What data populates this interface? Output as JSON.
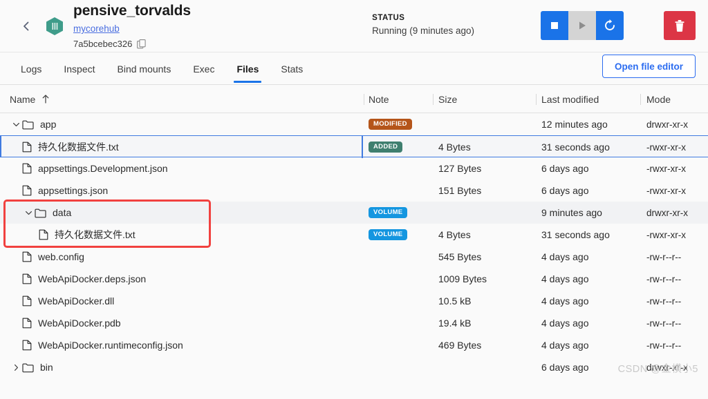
{
  "header": {
    "back_icon": "chevron-left-icon",
    "container_icon": "docker-container-icon",
    "title": "pensive_torvalds",
    "image_link": "mycorehub",
    "container_id": "7a5bcebec326",
    "copy_icon": "copy-icon",
    "status_label": "STATUS",
    "status_value": "Running (9 minutes ago)",
    "actions": {
      "stop": "stop-icon",
      "start": "play-icon",
      "restart": "restart-icon",
      "delete": "trash-icon"
    },
    "colors": {
      "primary_blue": "#1a73e8",
      "danger_red": "#dc3545",
      "disabled_gray": "#d4d4d4",
      "container_teal": "#3f9c8a",
      "link_blue": "#4a6ee0"
    }
  },
  "tabs": [
    {
      "label": "Logs",
      "active": false
    },
    {
      "label": "Inspect",
      "active": false
    },
    {
      "label": "Bind mounts",
      "active": false
    },
    {
      "label": "Exec",
      "active": false
    },
    {
      "label": "Files",
      "active": true
    },
    {
      "label": "Stats",
      "active": false
    }
  ],
  "toolbar": {
    "open_file_editor_label": "Open file editor"
  },
  "columns": {
    "name": "Name",
    "sort_icon": "sort-ascending-arrow-icon",
    "note": "Note",
    "size": "Size",
    "last_modified": "Last modified",
    "mode": "Mode"
  },
  "badge_colors": {
    "MODIFIED": "#b5551a",
    "ADDED": "#3f7f6f",
    "VOLUME": "#1496e0"
  },
  "rows": [
    {
      "name": "app",
      "type": "folder",
      "indent": 0,
      "chevron": "chevron-down-icon",
      "note": "MODIFIED",
      "size": "",
      "modified": "12 minutes ago",
      "mode": "drwxr-xr-x",
      "stripe": false,
      "selected": false
    },
    {
      "name": "持久化数据文件.txt",
      "type": "file",
      "indent": 1,
      "chevron": "",
      "note": "ADDED",
      "size": "4 Bytes",
      "modified": "31 seconds ago",
      "mode": "-rwxr-xr-x",
      "stripe": true,
      "selected": true
    },
    {
      "name": "appsettings.Development.json",
      "type": "file",
      "indent": 1,
      "chevron": "",
      "note": "",
      "size": "127 Bytes",
      "modified": "6 days ago",
      "mode": "-rwxr-xr-x",
      "stripe": false,
      "selected": false
    },
    {
      "name": "appsettings.json",
      "type": "file",
      "indent": 1,
      "chevron": "",
      "note": "",
      "size": "151 Bytes",
      "modified": "6 days ago",
      "mode": "-rwxr-xr-x",
      "stripe": false,
      "selected": false
    },
    {
      "name": "data",
      "type": "folder",
      "indent": 1,
      "chevron": "chevron-down-icon",
      "note": "VOLUME",
      "size": "",
      "modified": "9 minutes ago",
      "mode": "drwxr-xr-x",
      "stripe": true,
      "selected": false
    },
    {
      "name": "持久化数据文件.txt",
      "type": "file",
      "indent": 2,
      "chevron": "",
      "note": "VOLUME",
      "size": "4 Bytes",
      "modified": "31 seconds ago",
      "mode": "-rwxr-xr-x",
      "stripe": false,
      "selected": false
    },
    {
      "name": "web.config",
      "type": "file",
      "indent": 1,
      "chevron": "",
      "note": "",
      "size": "545 Bytes",
      "modified": "4 days ago",
      "mode": "-rw-r--r--",
      "stripe": false,
      "selected": false
    },
    {
      "name": "WebApiDocker.deps.json",
      "type": "file",
      "indent": 1,
      "chevron": "",
      "note": "",
      "size": "1009 Bytes",
      "modified": "4 days ago",
      "mode": "-rw-r--r--",
      "stripe": false,
      "selected": false
    },
    {
      "name": "WebApiDocker.dll",
      "type": "file",
      "indent": 1,
      "chevron": "",
      "note": "",
      "size": "10.5 kB",
      "modified": "4 days ago",
      "mode": "-rw-r--r--",
      "stripe": false,
      "selected": false
    },
    {
      "name": "WebApiDocker.pdb",
      "type": "file",
      "indent": 1,
      "chevron": "",
      "note": "",
      "size": "19.4 kB",
      "modified": "4 days ago",
      "mode": "-rw-r--r--",
      "stripe": false,
      "selected": false
    },
    {
      "name": "WebApiDocker.runtimeconfig.json",
      "type": "file",
      "indent": 1,
      "chevron": "",
      "note": "",
      "size": "469 Bytes",
      "modified": "4 days ago",
      "mode": "-rw-r--r--",
      "stripe": false,
      "selected": false
    },
    {
      "name": "bin",
      "type": "folder",
      "indent": 0,
      "chevron": "chevron-right-icon",
      "note": "",
      "size": "",
      "modified": "6 days ago",
      "mode": "drwxr-xr-x",
      "stripe": false,
      "selected": false
    }
  ],
  "annotation": {
    "color": "#f1413f",
    "target_rows": [
      4,
      5
    ]
  },
  "watermark": {
    "text": "CSDN @金横小5"
  }
}
